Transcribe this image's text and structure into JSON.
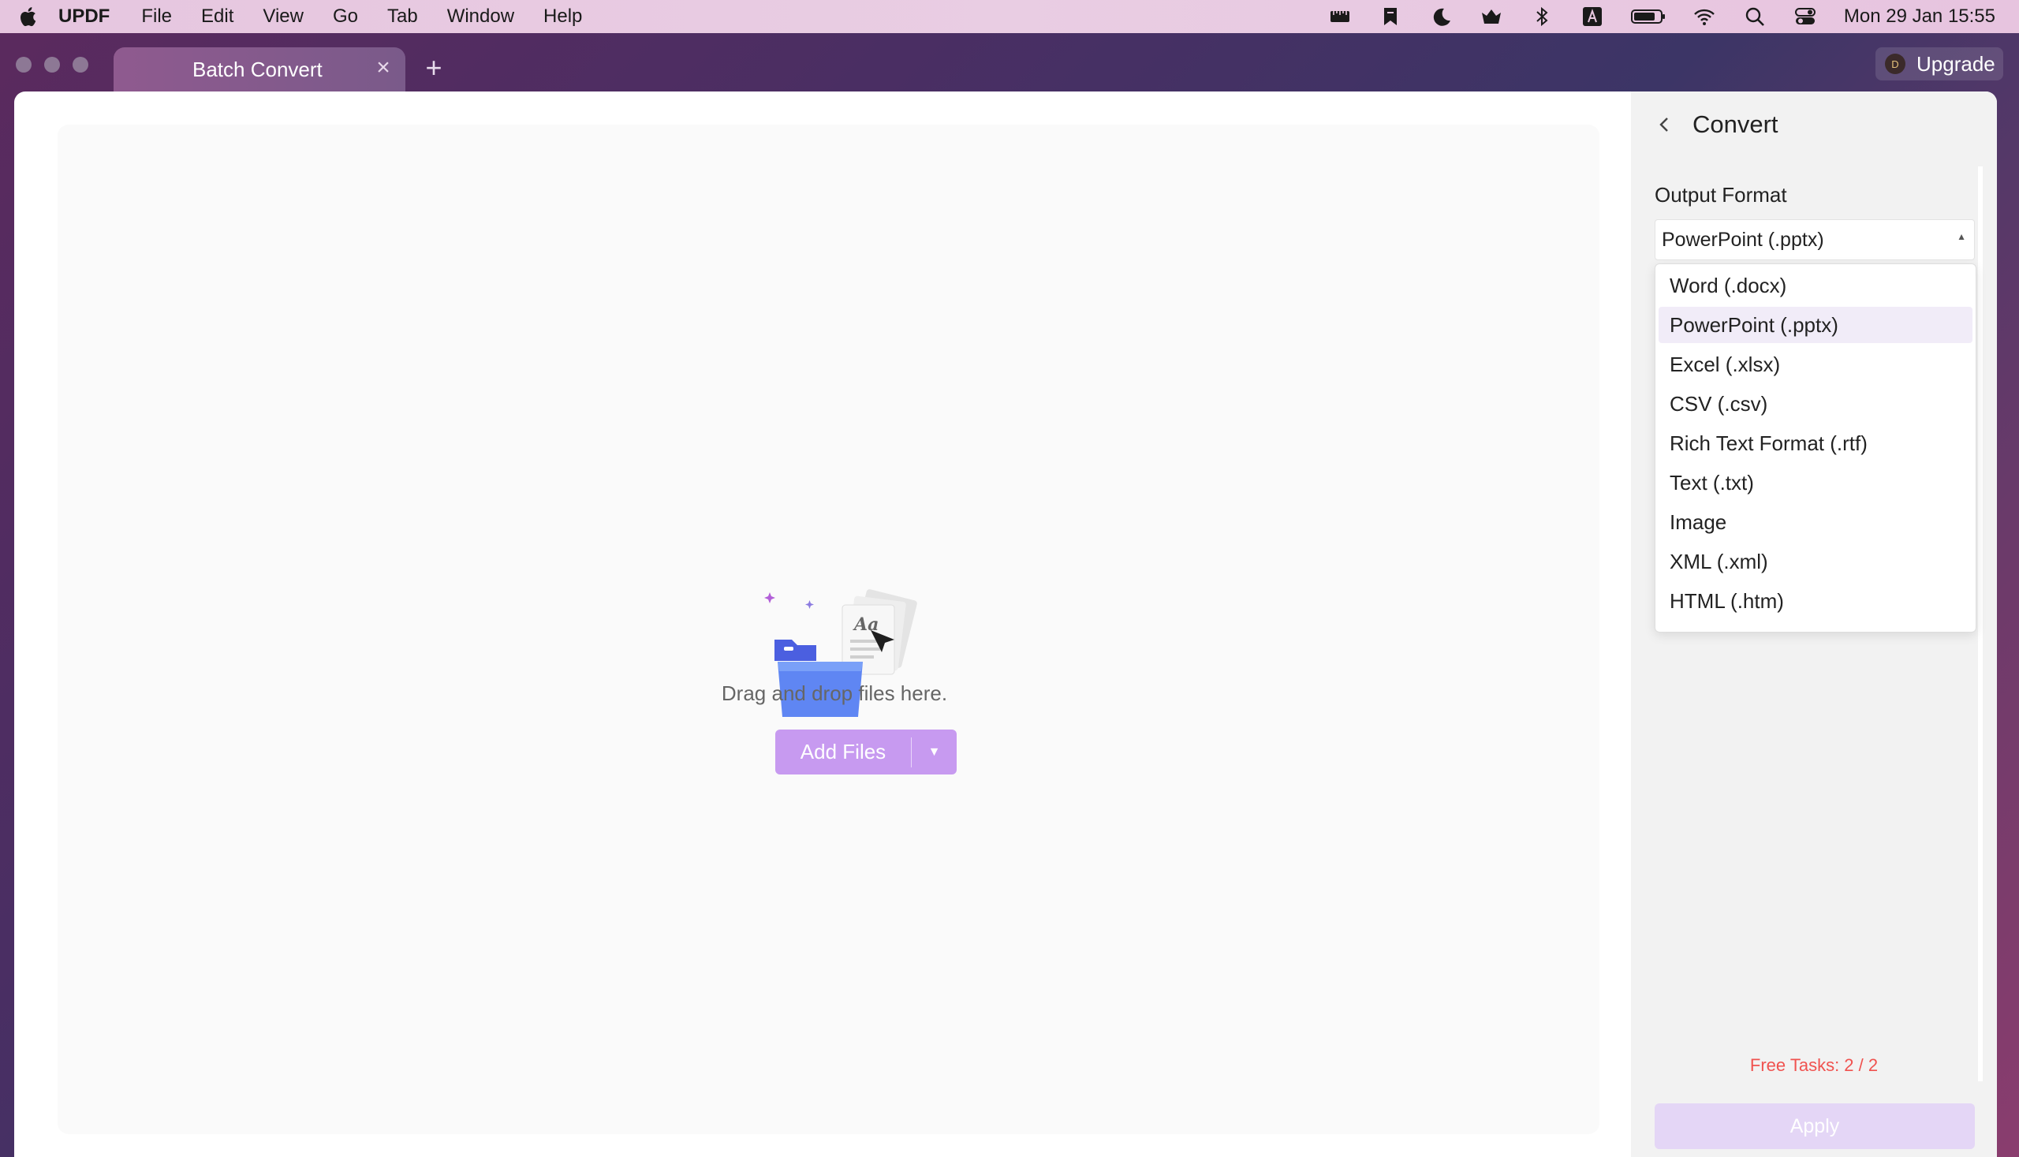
{
  "menubar": {
    "app_name": "UPDF",
    "items": [
      "File",
      "Edit",
      "View",
      "Go",
      "Tab",
      "Window",
      "Help"
    ],
    "status_icons": [
      "ruler-icon",
      "bookmark-icon",
      "moon-icon",
      "inbox-icon",
      "bluetooth-icon",
      "keyboard-a-icon",
      "battery-icon",
      "wifi-icon",
      "search-icon",
      "control-center-icon"
    ],
    "clock": "Mon 29 Jan  15:55"
  },
  "tabs": {
    "active_tab": "Batch Convert"
  },
  "upgrade": {
    "badge": "D",
    "label": "Upgrade"
  },
  "dropzone": {
    "text": "Drag and drop files here.",
    "add_files_label": "Add Files"
  },
  "panel": {
    "title": "Convert",
    "output_format_label": "Output Format",
    "selected_format": "PowerPoint (.pptx)",
    "options": [
      "Word (.docx)",
      "PowerPoint (.pptx)",
      "Excel (.xlsx)",
      "CSV (.csv)",
      "Rich Text Format (.rtf)",
      "Text (.txt)",
      "Image",
      "XML (.xml)",
      "HTML (.htm)"
    ],
    "free_tasks": "Free Tasks: 2 / 2",
    "apply_label": "Apply"
  },
  "colors": {
    "accent": "#c79af0",
    "apply_disabled": "#e4d6f6",
    "free_tasks": "#f0524f",
    "selected_option_bg": "#f1ecf8"
  }
}
